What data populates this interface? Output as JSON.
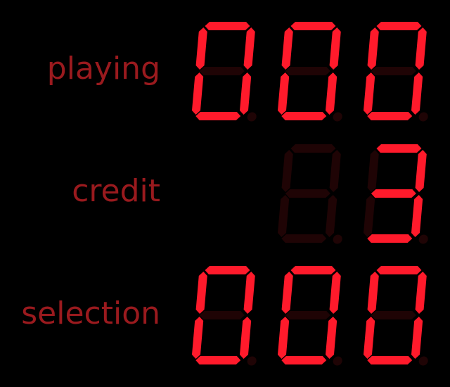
{
  "colors": {
    "segment_on": "#ff1a2b",
    "segment_off": "#1f0405",
    "label": "#9a1a1e",
    "background": "#000000"
  },
  "rows": [
    {
      "label": "playing",
      "value": "000",
      "digits": 3
    },
    {
      "label": "credit",
      "value": "3",
      "digits": 3,
      "visible_digits": 2
    },
    {
      "label": "selection",
      "value": "000",
      "digits": 3
    }
  ]
}
